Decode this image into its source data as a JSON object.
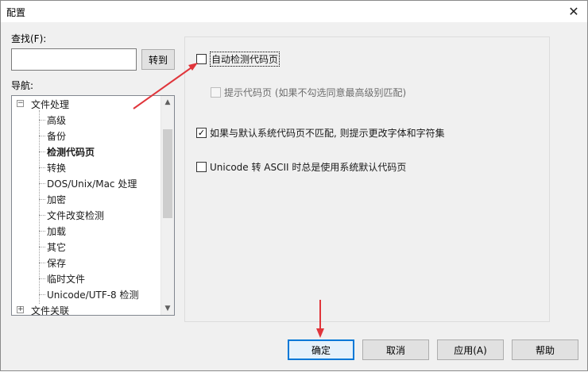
{
  "window": {
    "title": "配置",
    "close_glyph": "✕"
  },
  "search": {
    "label": "查找(F):",
    "value": "",
    "goto_label": "转到"
  },
  "nav": {
    "label": "导航:",
    "items": [
      {
        "label": "文件处理",
        "expander": "⊟",
        "level": 0
      },
      {
        "label": "高级",
        "level": 1
      },
      {
        "label": "备份",
        "level": 1
      },
      {
        "label": "检测代码页",
        "level": 1,
        "selected": true
      },
      {
        "label": "转换",
        "level": 1
      },
      {
        "label": "DOS/Unix/Mac 处理",
        "level": 1
      },
      {
        "label": "加密",
        "level": 1
      },
      {
        "label": "文件改变检测",
        "level": 1
      },
      {
        "label": "加载",
        "level": 1
      },
      {
        "label": "其它",
        "level": 1
      },
      {
        "label": "保存",
        "level": 1
      },
      {
        "label": "临时文件",
        "level": 1
      },
      {
        "label": "Unicode/UTF-8 检测",
        "level": 1
      },
      {
        "label": "文件关联",
        "expander": "⊞",
        "level": 0
      }
    ],
    "scroll_up": "▲",
    "scroll_down": "▼"
  },
  "options": {
    "auto_detect": {
      "label": "自动检测代码页",
      "checked": false
    },
    "prompt_codepage": {
      "label": "提示代码页 (如果不勾选同意最高级别匹配)",
      "checked": false,
      "disabled": true
    },
    "mismatch_prompt": {
      "label": "如果与默认系统代码页不匹配, 则提示更改字体和字符集",
      "checked": true,
      "check_glyph": "✓"
    },
    "unicode_ascii": {
      "label": "Unicode 转 ASCII 时总是使用系统默认代码页",
      "checked": false
    }
  },
  "buttons": {
    "ok": "确定",
    "cancel": "取消",
    "apply": "应用(A)",
    "help": "帮助"
  },
  "annotation": {
    "arrow_color": "#e0353b"
  }
}
